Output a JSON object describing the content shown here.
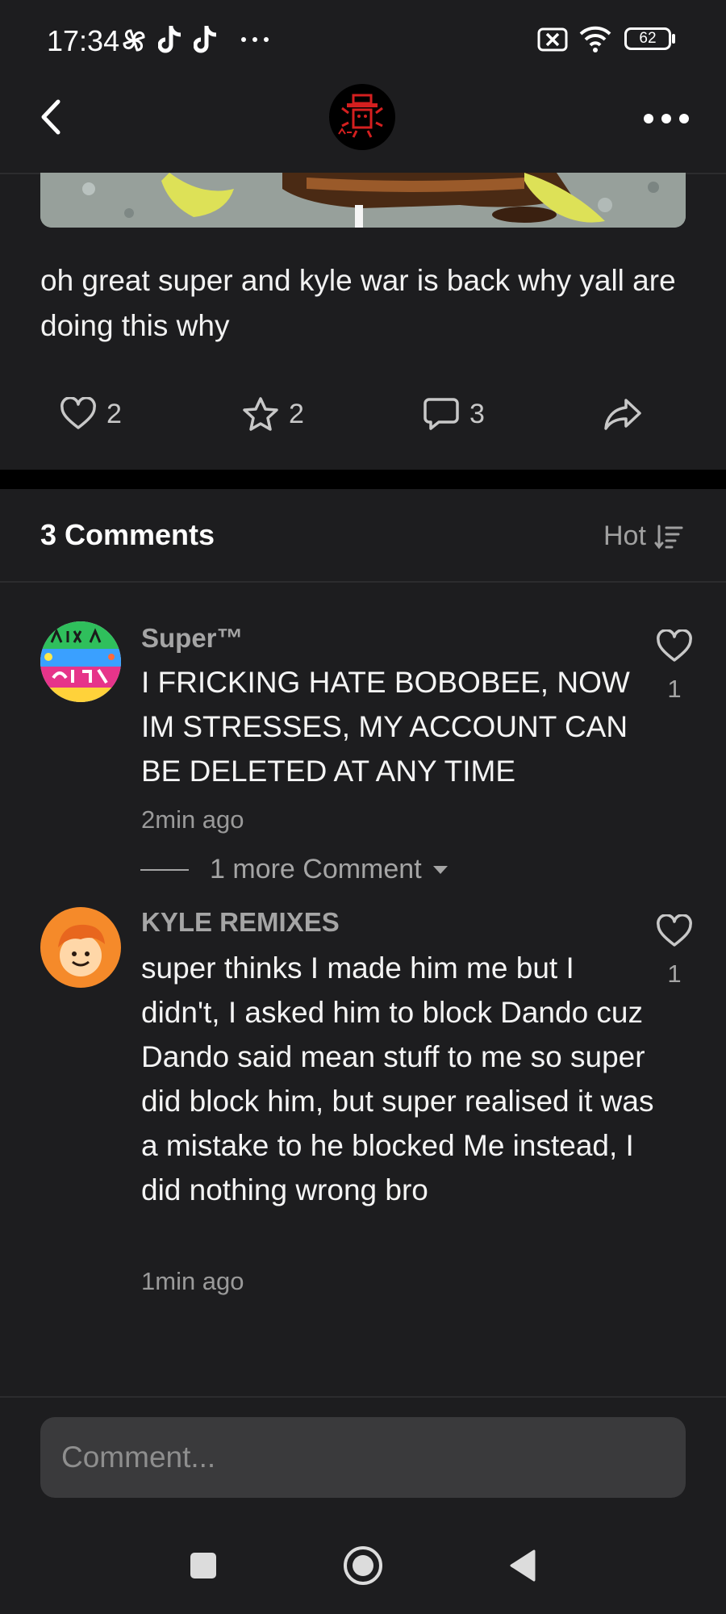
{
  "status_bar": {
    "time": "17:34",
    "battery": "62",
    "icons": [
      "pinwheel-icon",
      "tiktok-icon",
      "tiktok-icon",
      "more-dots-icon",
      "data-off-icon",
      "wifi-icon",
      "battery-icon"
    ]
  },
  "header": {
    "back_icon": "chevron-left-icon",
    "logo_icon": "channel-logo",
    "menu_icon": "more-horizontal-icon"
  },
  "post": {
    "text": "oh great super and kyle war is back why yall are doing this why",
    "actions": {
      "likes": "2",
      "favorites": "2",
      "comments": "3"
    }
  },
  "comments_section": {
    "title": "3 Comments",
    "sort_label": "Hot",
    "comments": [
      {
        "author": "Super™",
        "text": "I FRICKING HATE BOBOBEE, NOW IM STRESSES, MY ACCOUNT CAN BE DELETED AT ANY TIME",
        "time": "2min ago",
        "likes": "1",
        "more_replies": "1 more Comment"
      },
      {
        "author": "KYLE REMIXES",
        "text": "super thinks I made him me but I didn't, I asked him to block Dando cuz Dando said mean stuff to me so super did block him, but super realised it was a mistake to he blocked Me instead, I did nothing wrong bro",
        "time": "1min ago",
        "likes": "1"
      }
    ]
  },
  "comment_input": {
    "placeholder": "Comment..."
  },
  "colors": {
    "background": "#1d1d1f",
    "input_bg": "#3a3a3c",
    "muted_text": "#a5a5a5"
  }
}
